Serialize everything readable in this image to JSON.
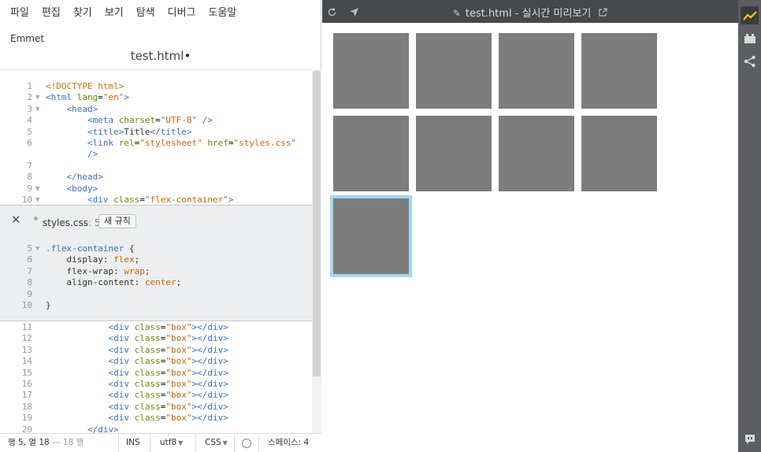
{
  "menu": [
    "파일",
    "편집",
    "찾기",
    "보기",
    "탐색",
    "디버그",
    "도움말"
  ],
  "emmet_label": "Emmet",
  "document": {
    "title": "test.html",
    "dirty_marker": "•"
  },
  "html_top_lines": [
    {
      "num": "1",
      "fold": "",
      "text": "<!DOCTYPE html>"
    },
    {
      "num": "2",
      "fold": "▼",
      "text": "<html lang=\"en\">"
    },
    {
      "num": "3",
      "fold": "▼",
      "text": "    <head>"
    },
    {
      "num": "4",
      "fold": "",
      "text": "        <meta charset=\"UTF-8\" />"
    },
    {
      "num": "5",
      "fold": "",
      "text": "        <title>Title</title>"
    },
    {
      "num": "6",
      "fold": "",
      "text": "        <link rel=\"stylesheet\" href=\"styles.css\""
    },
    {
      "num": "",
      "fold": "",
      "text": "        />"
    },
    {
      "num": "7",
      "fold": "",
      "text": ""
    },
    {
      "num": "8",
      "fold": "",
      "text": "    </head>"
    },
    {
      "num": "9",
      "fold": "▼",
      "text": "    <body>"
    },
    {
      "num": "10",
      "fold": "▼",
      "text": "        <div class=\"flex-container\">"
    }
  ],
  "inline_editor": {
    "close_glyph": "✕",
    "file": "styles.css",
    "line_ref": ": 5",
    "new_rule_label": "새 규칙",
    "lines": [
      {
        "num": "5",
        "fold": "▼",
        "text": ".flex-container {"
      },
      {
        "num": "6",
        "fold": "",
        "text": "    display: flex;"
      },
      {
        "num": "7",
        "fold": "",
        "text": "    flex-wrap: wrap;"
      },
      {
        "num": "8",
        "fold": "",
        "text": "    align-content: center;"
      },
      {
        "num": "9",
        "fold": "",
        "text": ""
      },
      {
        "num": "10",
        "fold": "",
        "text": "}"
      }
    ]
  },
  "html_bottom_lines": [
    {
      "num": "11",
      "fold": "",
      "text": "            <div class=\"box\"></div>"
    },
    {
      "num": "12",
      "fold": "",
      "text": "            <div class=\"box\"></div>"
    },
    {
      "num": "13",
      "fold": "",
      "text": "            <div class=\"box\"></div>"
    },
    {
      "num": "14",
      "fold": "",
      "text": "            <div class=\"box\"></div>"
    },
    {
      "num": "15",
      "fold": "",
      "text": "            <div class=\"box\"></div>"
    },
    {
      "num": "16",
      "fold": "",
      "text": "            <div class=\"box\"></div>"
    },
    {
      "num": "17",
      "fold": "",
      "text": "            <div class=\"box\"></div>"
    },
    {
      "num": "18",
      "fold": "",
      "text": "            <div class=\"box\"></div>"
    },
    {
      "num": "19",
      "fold": "",
      "text": "            <div class=\"box\"></div>"
    },
    {
      "num": "20",
      "fold": "",
      "text": "        </div>"
    }
  ],
  "status": {
    "position_prefix": "행 5, 열 ",
    "position_col": "18",
    "position_total": " — 18 행",
    "mode": "INS",
    "encoding": "utf8",
    "language": "CSS",
    "indent": "스페이스: 4"
  },
  "preview": {
    "title": "test.html - 실시간 미리보기",
    "refresh_icon": "refresh-icon",
    "inspect_icon": "cursor-arrow-icon",
    "pin_icon": "pin-icon",
    "popout_icon": "external-link-icon",
    "box_count": 9,
    "selected_box_index": 8,
    "box_color": "#7d7d7d",
    "selection_color": "#a6d6f4"
  },
  "side_toolbar": [
    "live-preview-icon",
    "extensions-icon",
    "share-icon",
    "feedback-icon"
  ]
}
